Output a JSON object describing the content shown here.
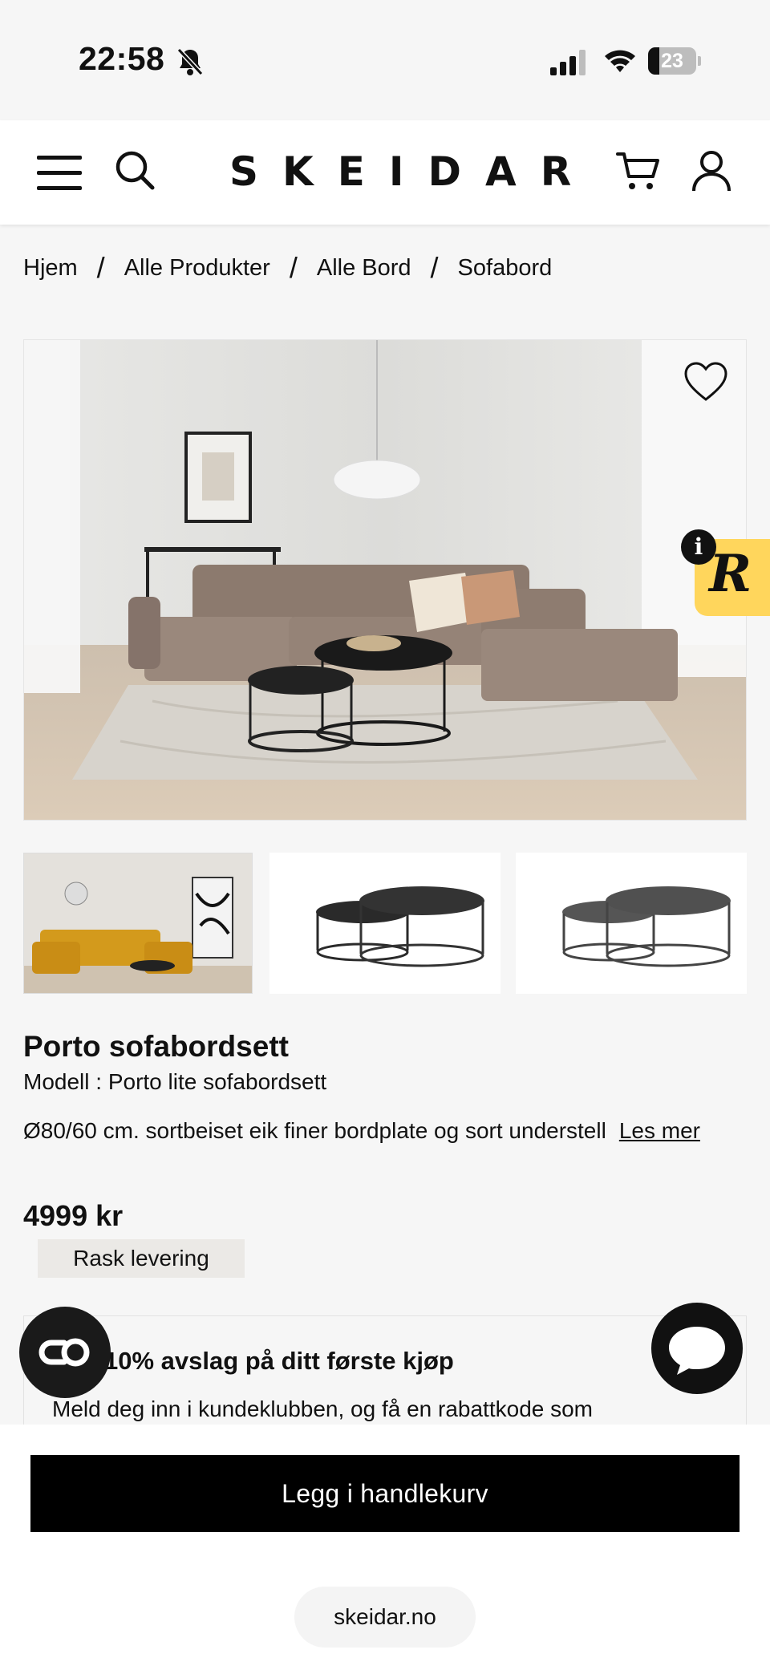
{
  "status": {
    "time": "22:58",
    "battery": "23"
  },
  "brand": {
    "logo": "SKEIDAR"
  },
  "breadcrumb": [
    "Hjem",
    "Alle Produkter",
    "Alle Bord",
    "Sofabord"
  ],
  "breadcrumb_separator": "/",
  "product": {
    "title": "Porto sofabordsett",
    "model": "Modell : Porto lite sofabordsett",
    "description": "Ø80/60 cm. sortbeiset eik finer bordplate og sort understell",
    "read_more": "Les mer",
    "price": "4999 kr",
    "badge": "Rask levering"
  },
  "club": {
    "heading": "10% avslag på ditt første kjøp",
    "text": "Meld deg inn i kundeklubben, og få en rabattkode som"
  },
  "cta": {
    "add_to_cart": "Legg i handlekurv"
  },
  "browser": {
    "url": "skeidar.no"
  },
  "badges": {
    "reviews_letter": "R",
    "info_letter": "i"
  },
  "icons": [
    "bell-slash-icon",
    "signal-icon",
    "wifi-icon",
    "menu-icon",
    "search-icon",
    "cart-icon",
    "user-icon",
    "heart-icon",
    "chat-icon",
    "co-browse-icon"
  ],
  "colors": {
    "accent_yellow": "#ffd65c",
    "cta": "#000000",
    "badge_bg": "#ebe9e6"
  }
}
